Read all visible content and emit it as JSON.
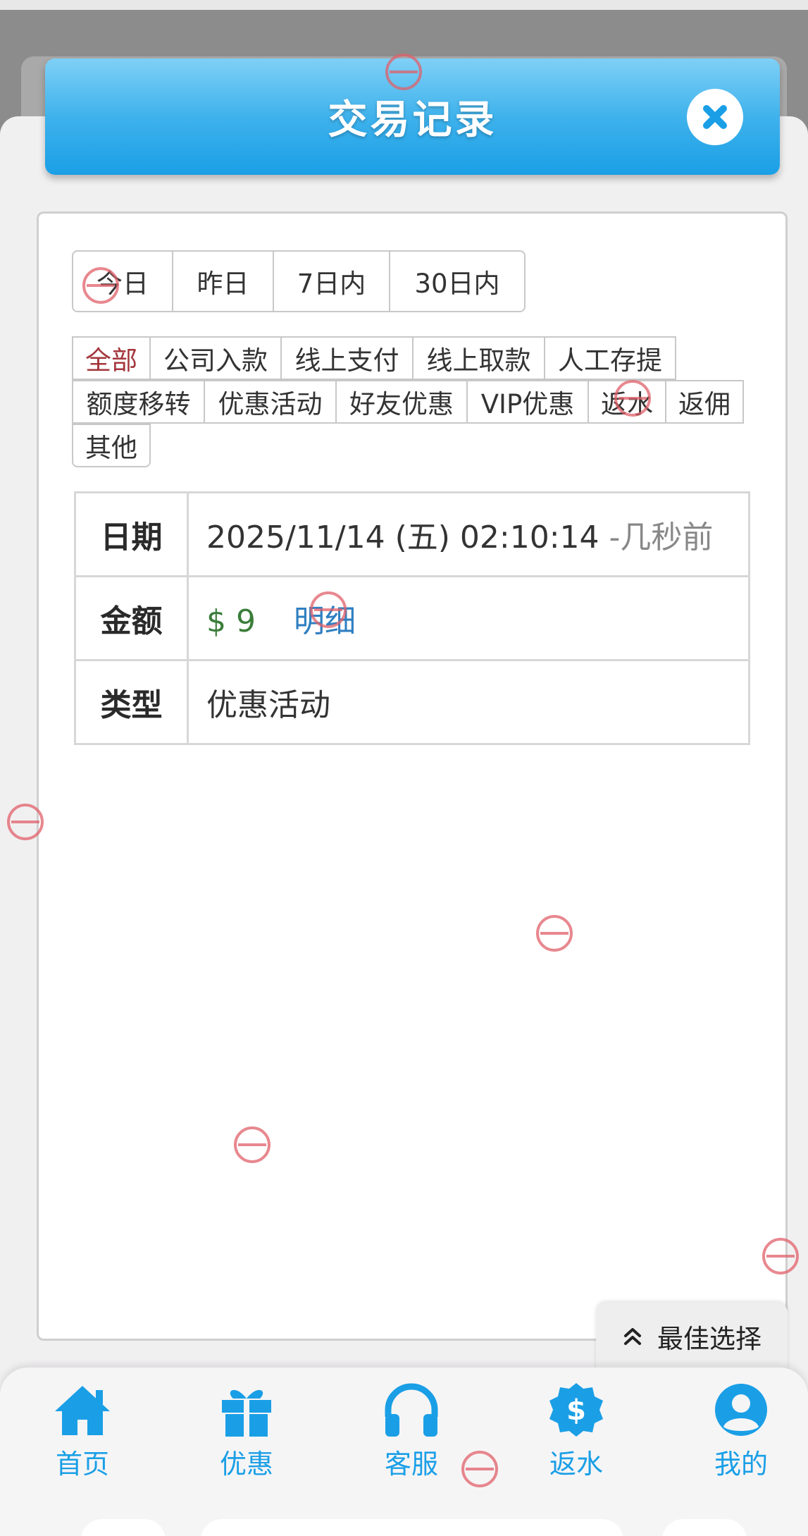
{
  "header": {
    "title": "交易记录",
    "close_icon": "close-icon"
  },
  "date_filters": [
    "今日",
    "昨日",
    "7日内",
    "30日内"
  ],
  "categories": {
    "row1": [
      "全部",
      "公司入款",
      "线上支付",
      "线上取款",
      "人工存提"
    ],
    "row2": [
      "额度移转",
      "优惠活动",
      "好友优惠",
      "VIP优惠",
      "返水",
      "返佣"
    ],
    "row3": [
      "其他"
    ],
    "active": "全部"
  },
  "record": {
    "date_label": "日期",
    "date_value": "2025/11/14 (五) 02:10:14",
    "date_relative": "-几秒前",
    "amount_label": "金额",
    "amount_value": "$ 9",
    "detail_link": "明细",
    "type_label": "类型",
    "type_value": "优惠活动"
  },
  "best_choice": {
    "label": "最佳选择",
    "icon": "chevron-up-double-icon"
  },
  "tabbar": [
    {
      "label": "首页",
      "icon": "home-icon"
    },
    {
      "label": "优惠",
      "icon": "gift-icon"
    },
    {
      "label": "客服",
      "icon": "headset-icon"
    },
    {
      "label": "返水",
      "icon": "dollar-badge-icon"
    },
    {
      "label": "我的",
      "icon": "user-icon"
    }
  ],
  "colors": {
    "accent": "#1a9fe6",
    "active_category": "#a3353b",
    "money": "#3a7d3a",
    "link": "#2f7fc1"
  }
}
